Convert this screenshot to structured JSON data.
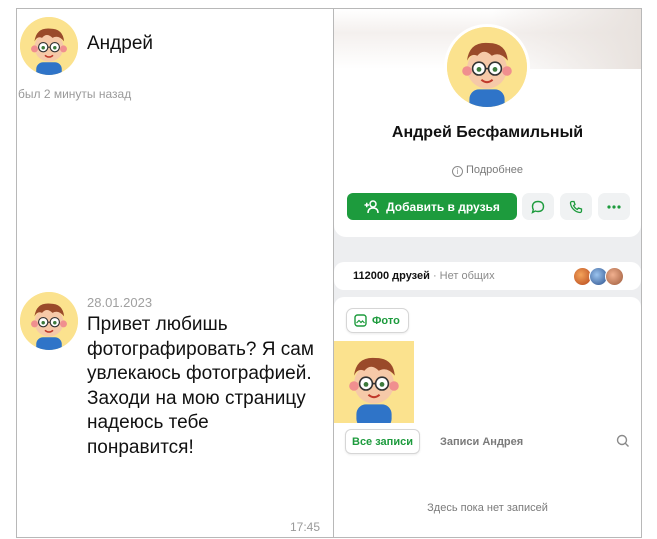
{
  "chat": {
    "contact_name": "Андрей",
    "last_seen": "был 2 минуты назад",
    "message": {
      "date": "28.01.2023",
      "text": "Привет любишь фотографировать? Я сам увлекаюсь фотографией. Заходи на мою страницу надеюсь тебе понравится!",
      "time": "17:45"
    }
  },
  "profile": {
    "full_name": "Андрей Бесфамильный",
    "more_info": "Подробнее",
    "add_friend_label": "Добавить в друзья",
    "friends": {
      "count_label": "112000 друзей",
      "common_label": "· Нет общих"
    },
    "photo_tab_label": "Фото",
    "posts": {
      "all_label": "Все записи",
      "own_label": "Записи Андрея",
      "empty_text": "Здесь пока нет записей"
    }
  },
  "colors": {
    "accent_green": "#1d9b3d",
    "avatar_bg": "#fbe28e",
    "panel_bg": "#edeef0"
  },
  "icons": [
    "add-friend-icon",
    "message-icon",
    "phone-icon",
    "more-icon",
    "info-icon",
    "photo-icon",
    "search-icon"
  ]
}
